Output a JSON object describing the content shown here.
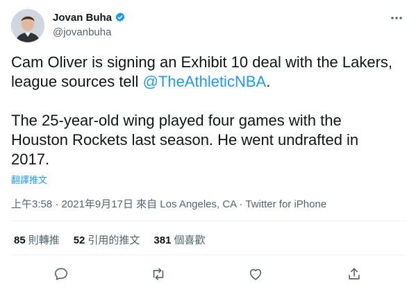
{
  "author": {
    "name": "Jovan Buha",
    "handle": "@jovanbuha",
    "verified": true
  },
  "tweet": {
    "line1_before": "Cam Oliver is signing an Exhibit 10 deal with the Lakers, league sources tell ",
    "mention": "@TheAthleticNBA",
    "line1_after": ".",
    "paragraph2": "The 25-year-old wing played four games with the Houston Rockets last season. He went undrafted in 2017.",
    "translate_label": "翻譯推文"
  },
  "meta": {
    "time": "上午3:58",
    "separator": " · ",
    "date": "2021年9月17日",
    "location": " 來自 Los Angeles, CA",
    "source": "Twitter for iPhone"
  },
  "stats": [
    {
      "count": "85",
      "label": "則轉推"
    },
    {
      "count": "52",
      "label": "引用的推文"
    },
    {
      "count": "381",
      "label": "個喜歡"
    }
  ],
  "icons": {
    "verified": "verified-badge-icon",
    "more": "more-options-icon",
    "reply": "reply-icon",
    "retweet": "retweet-icon",
    "like": "like-icon",
    "share": "share-icon"
  },
  "colors": {
    "accent": "#1d9bf0",
    "text": "#0f1419",
    "secondary": "#536471",
    "divider": "#eff3f4"
  }
}
